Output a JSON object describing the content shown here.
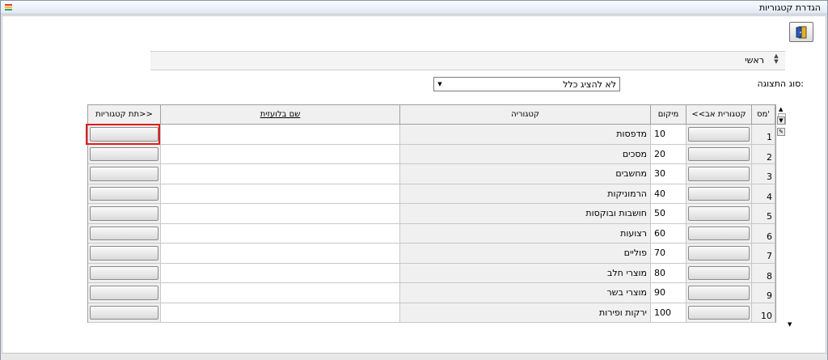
{
  "window": {
    "title": "הגדרת קטגוריות",
    "app_icon": "app-logo-icon",
    "exit_icon": "exit-door-icon"
  },
  "parent": {
    "label": "ראשי"
  },
  "display_type": {
    "label": "סוג התצוגה:",
    "selected": "לא להציג כלל"
  },
  "table": {
    "columns": {
      "num": "מס'",
      "parent_category": "<<קטגורית אב",
      "location": "מיקום",
      "category": "קטגוריה",
      "foreign_name": "שם בלועזית",
      "subcategories": "תת קטגוריות>>"
    },
    "rows": [
      {
        "num": "1",
        "location": "10",
        "category": "מדפסות"
      },
      {
        "num": "2",
        "location": "20",
        "category": "מסכים"
      },
      {
        "num": "3",
        "location": "30",
        "category": "מחשבים"
      },
      {
        "num": "4",
        "location": "40",
        "category": "הרמוניקות"
      },
      {
        "num": "5",
        "location": "50",
        "category": "חושבות ובוקסות"
      },
      {
        "num": "6",
        "location": "60",
        "category": "רצועות"
      },
      {
        "num": "7",
        "location": "70",
        "category": "פוליים"
      },
      {
        "num": "8",
        "location": "80",
        "category": "מוצרי חלב"
      },
      {
        "num": "9",
        "location": "90",
        "category": "מוצרי בשר"
      },
      {
        "num": "10",
        "location": "100",
        "category": "ירקות ופירות"
      }
    ]
  },
  "colors": {
    "highlight": "#e21b1b"
  }
}
